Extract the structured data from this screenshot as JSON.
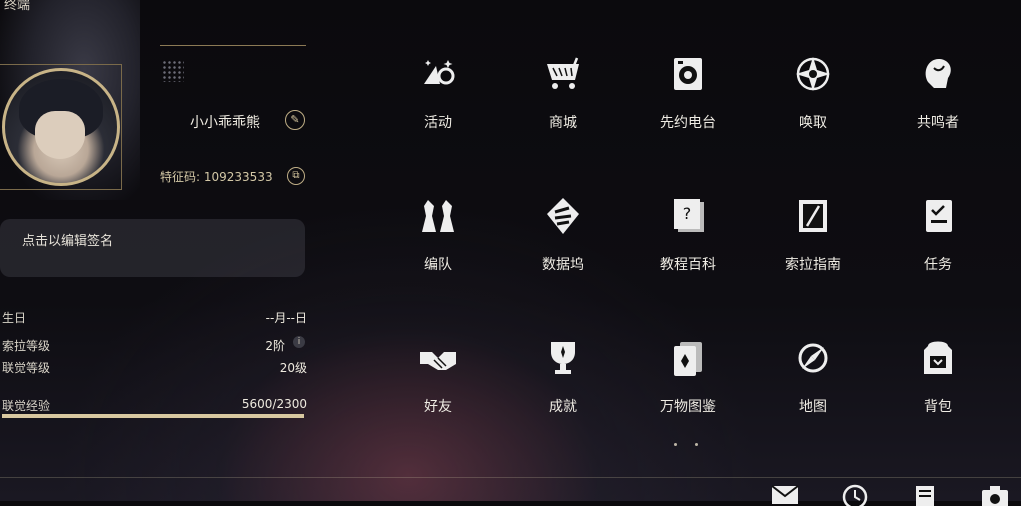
{
  "window": {
    "title": "终端"
  },
  "profile": {
    "username": "小小乖乖熊",
    "id_label": "特征码:",
    "id_value": "109233533",
    "signature_placeholder": "点击以编辑签名"
  },
  "stats": [
    {
      "label": "生日",
      "value": "--月--日"
    },
    {
      "label": "索拉等级",
      "value": "2阶"
    },
    {
      "label": "联觉等级",
      "value": "20级"
    },
    {
      "label": "联觉经验",
      "value": "5600/2300"
    }
  ],
  "experience": {
    "fill_fraction": 1.0
  },
  "menu": [
    {
      "label": "活动",
      "icon": "activity-icon"
    },
    {
      "label": "商城",
      "icon": "shop-cart-icon"
    },
    {
      "label": "先约电台",
      "icon": "radio-icon"
    },
    {
      "label": "唤取",
      "icon": "summon-star-icon"
    },
    {
      "label": "共鸣者",
      "icon": "resonator-icon"
    },
    {
      "label": "编队",
      "icon": "team-icon"
    },
    {
      "label": "数据坞",
      "icon": "data-dock-icon"
    },
    {
      "label": "教程百科",
      "icon": "tutorial-icon"
    },
    {
      "label": "索拉指南",
      "icon": "guide-icon"
    },
    {
      "label": "任务",
      "icon": "quest-icon"
    },
    {
      "label": "好友",
      "icon": "friends-icon"
    },
    {
      "label": "成就",
      "icon": "achievement-icon"
    },
    {
      "label": "万物图鉴",
      "icon": "compendium-icon"
    },
    {
      "label": "地图",
      "icon": "map-icon"
    },
    {
      "label": "背包",
      "icon": "backpack-icon"
    }
  ],
  "bottom_bar": [
    "mail-icon",
    "clock-icon",
    "notes-icon",
    "camera-icon"
  ],
  "colors": {
    "accent": "#c8b487",
    "text": "#efece4"
  }
}
